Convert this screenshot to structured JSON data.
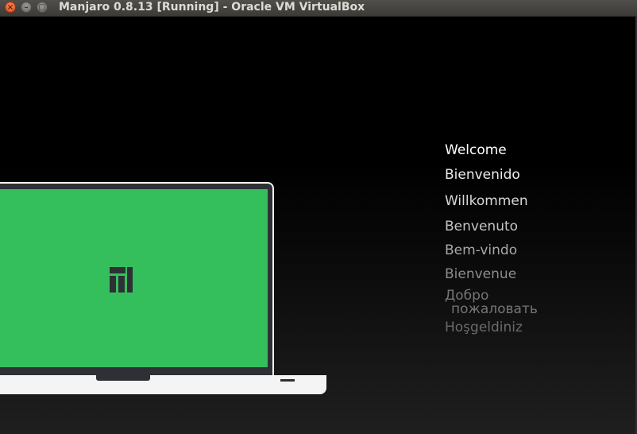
{
  "window": {
    "title": "Manjaro 0.8.13 [Running] - Oracle VM VirtualBox",
    "controls": {
      "close": "×",
      "minimize": "–",
      "maximize": "□"
    }
  },
  "screen": {
    "illustration": {
      "screen_color": "#35bf5c",
      "frame_color": "#2e3036",
      "logo_icon": "manjaro-logo"
    },
    "welcome_messages": [
      {
        "text": "Welcome",
        "color": "#ffffff"
      },
      {
        "text": "Bienvenido",
        "color": "#ececec"
      },
      {
        "text": "Willkommen",
        "color": "#d8d8d8"
      },
      {
        "text": "Benvenuto",
        "color": "#c4c4c4"
      },
      {
        "text": "Bem-vindo",
        "color": "#a8a8a8"
      },
      {
        "text": "Bienvenue",
        "color": "#8c8c8c"
      },
      {
        "text": "Добро",
        "color": "#757575"
      },
      {
        "text": "пожаловать",
        "color": "#757575"
      },
      {
        "text": "Hoşgeldiniz",
        "color": "#6a6a6a"
      }
    ]
  }
}
